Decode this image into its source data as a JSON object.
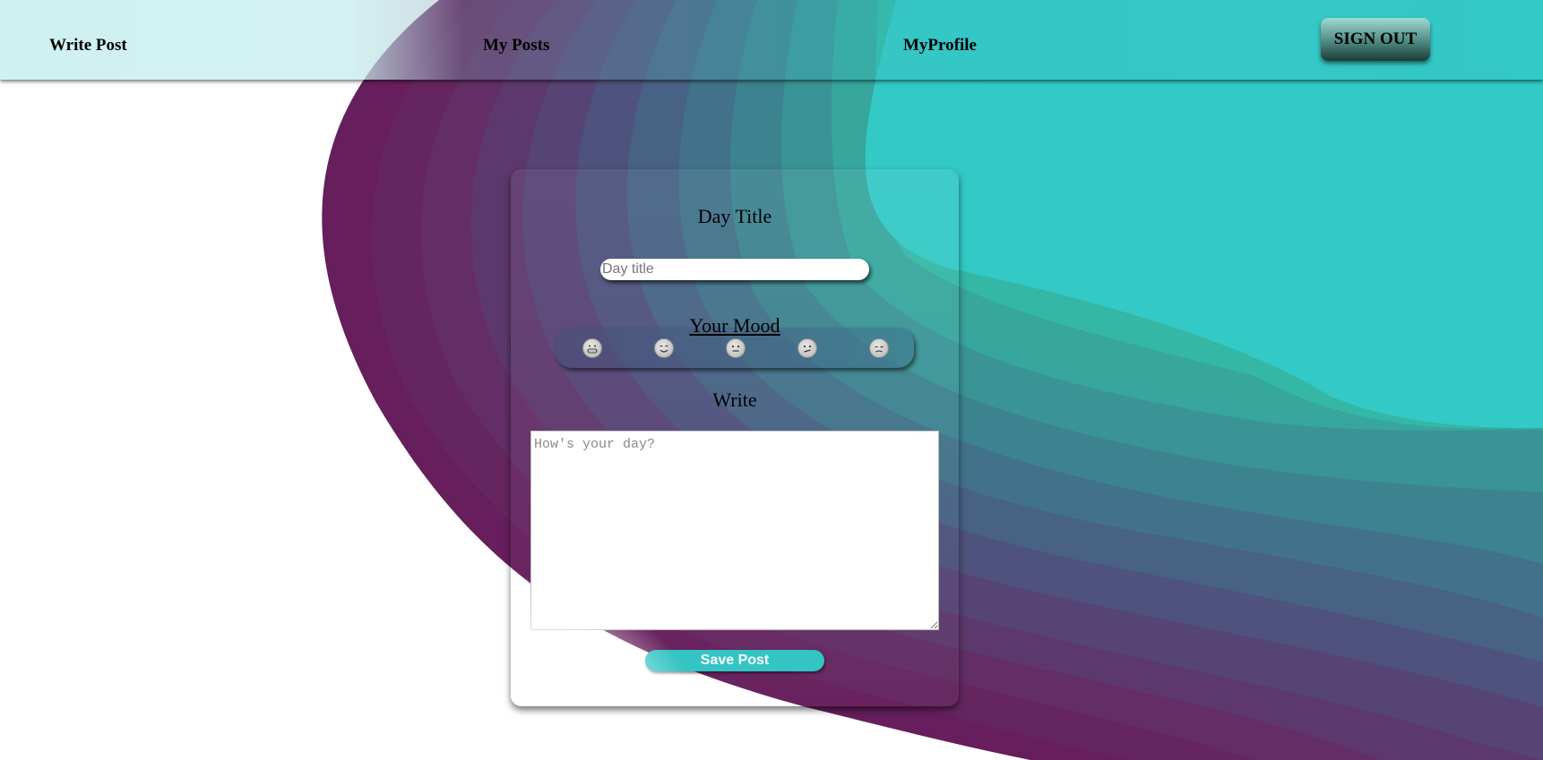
{
  "nav": {
    "write_post": "Write Post",
    "my_posts": "My Posts",
    "my_profile": "MyProfile",
    "sign_out": "SIGN OUT"
  },
  "form": {
    "day_title_label": "Day Title",
    "day_title_placeholder": "Day title",
    "mood_label": "Your Mood",
    "moods": [
      "grinning-face-icon",
      "smiling-face-icon",
      "neutral-face-icon",
      "confused-face-icon",
      "pensive-face-icon"
    ],
    "write_label": "Write",
    "write_placeholder": "How's your day?",
    "save_label": "Save Post"
  },
  "colors": {
    "accent": "#33c4c4",
    "purple": "#661e5c",
    "teal": "#33c9c6"
  }
}
